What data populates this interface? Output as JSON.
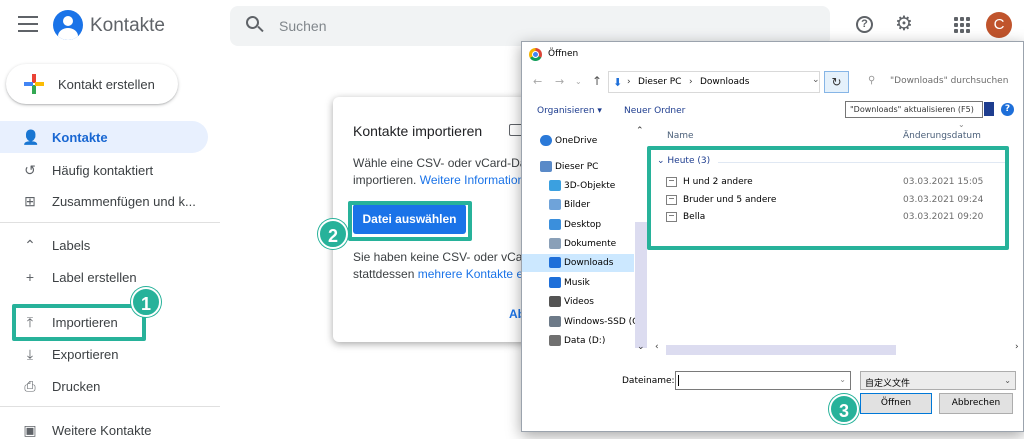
{
  "header": {
    "app_title": "Kontakte",
    "search_placeholder": "Suchen",
    "user_initial": "C",
    "icons": [
      "menu-icon",
      "contacts-logo-icon",
      "search-icon",
      "help-icon",
      "settings-gear-icon",
      "apps-grid-icon"
    ]
  },
  "sidebar": {
    "create_label": "Kontakt erstellen",
    "items": [
      {
        "label": "Kontakte",
        "icon": "person-icon",
        "active": true
      },
      {
        "label": "Häufig kontaktiert",
        "icon": "history-icon"
      },
      {
        "label": "Zusammenfügen und k...",
        "icon": "merge-icon"
      },
      {
        "label": "Labels",
        "icon": "chevron-up-icon"
      },
      {
        "label": "Label erstellen",
        "icon": "plus-icon"
      },
      {
        "label": "Importieren",
        "icon": "upload-icon"
      },
      {
        "label": "Exportieren",
        "icon": "download-icon"
      },
      {
        "label": "Drucken",
        "icon": "print-icon"
      },
      {
        "label": "Weitere Kontakte",
        "icon": "contacts-box-icon"
      }
    ]
  },
  "import_modal": {
    "title": "Kontakte importieren",
    "text1": "Wähle eine CSV- oder vCard-Date",
    "text1b": "importieren. ",
    "text1_link": "Weitere Information",
    "choose_button": "Datei auswählen",
    "text2": "Sie haben keine CSV- oder vCard-",
    "text2b": "stattdessen ",
    "text2_link": "mehrere Kontakte er",
    "abort_partial": "Ab"
  },
  "annotations": {
    "step1": "1",
    "step2": "2",
    "step3": "3",
    "highlight_color": "#27b29a"
  },
  "file_dialog": {
    "title": "Öffnen",
    "path": {
      "root": "Dieser PC",
      "folder": "Downloads"
    },
    "search_placeholder": "\"Downloads\" durchsuchen",
    "toolbar": {
      "organize": "Organisieren",
      "new_folder": "Neuer Ordner"
    },
    "refresh_tooltip": "\"Downloads\" aktualisieren (F5)",
    "tree": [
      {
        "label": "OneDrive",
        "color": "#2b79d8"
      },
      {
        "label": "Dieser PC",
        "color": "#5a8ac8"
      },
      {
        "label": "3D-Objekte",
        "color": "#3ba0e0"
      },
      {
        "label": "Bilder",
        "color": "#6fa3d9"
      },
      {
        "label": "Desktop",
        "color": "#3b8fdc"
      },
      {
        "label": "Dokumente",
        "color": "#8aa0b8"
      },
      {
        "label": "Downloads",
        "color": "#1e6fd9",
        "selected": true
      },
      {
        "label": "Musik",
        "color": "#1e6fd9"
      },
      {
        "label": "Videos",
        "color": "#545454"
      },
      {
        "label": "Windows-SSD (C",
        "color": "#6d7a88"
      },
      {
        "label": "Data (D:)",
        "color": "#707070"
      }
    ],
    "columns": {
      "name": "Name",
      "date": "Änderungsdatum"
    },
    "group": "Heute (3)",
    "files": [
      {
        "name": "H und 2 andere",
        "date": "03.03.2021 15:05"
      },
      {
        "name": "Bruder und 5 andere",
        "date": "03.03.2021 09:24"
      },
      {
        "name": "Bella",
        "date": "03.03.2021 09:20"
      }
    ],
    "filename_label": "Dateiname:",
    "filetype": "自定义文件",
    "open_button": "Öffnen",
    "cancel_button": "Abbrechen"
  }
}
